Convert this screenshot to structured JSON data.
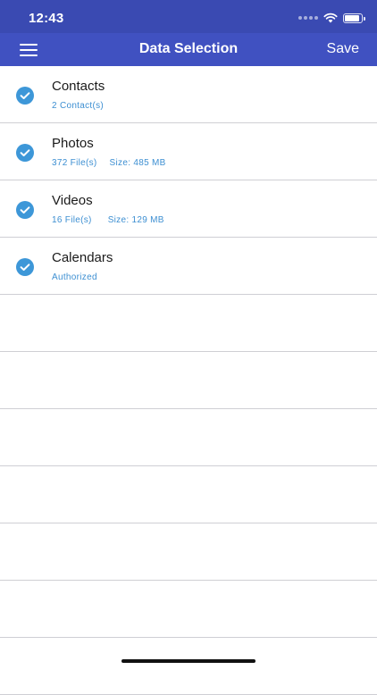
{
  "status_bar": {
    "time": "12:43"
  },
  "nav": {
    "title": "Data Selection",
    "save_label": "Save"
  },
  "items": [
    {
      "title": "Contacts",
      "count": "2 Contact(s)",
      "size": "",
      "checked": true
    },
    {
      "title": "Photos",
      "count": "372 File(s)",
      "size": "Size: 485 MB",
      "checked": true
    },
    {
      "title": "Videos",
      "count": "16 File(s)",
      "size": "Size: 129 MB",
      "checked": true
    },
    {
      "title": "Calendars",
      "count": "Authorized",
      "size": "",
      "checked": true
    }
  ],
  "colors": {
    "status_bar": "#3a4ab2",
    "nav_bar": "#4051c1",
    "check": "#3d97d8",
    "subtitle": "#3d8fd2"
  },
  "icons": {
    "menu": "hamburger-menu-icon",
    "check": "checkmark-circle-icon",
    "wifi": "wifi-icon",
    "battery": "battery-icon"
  }
}
